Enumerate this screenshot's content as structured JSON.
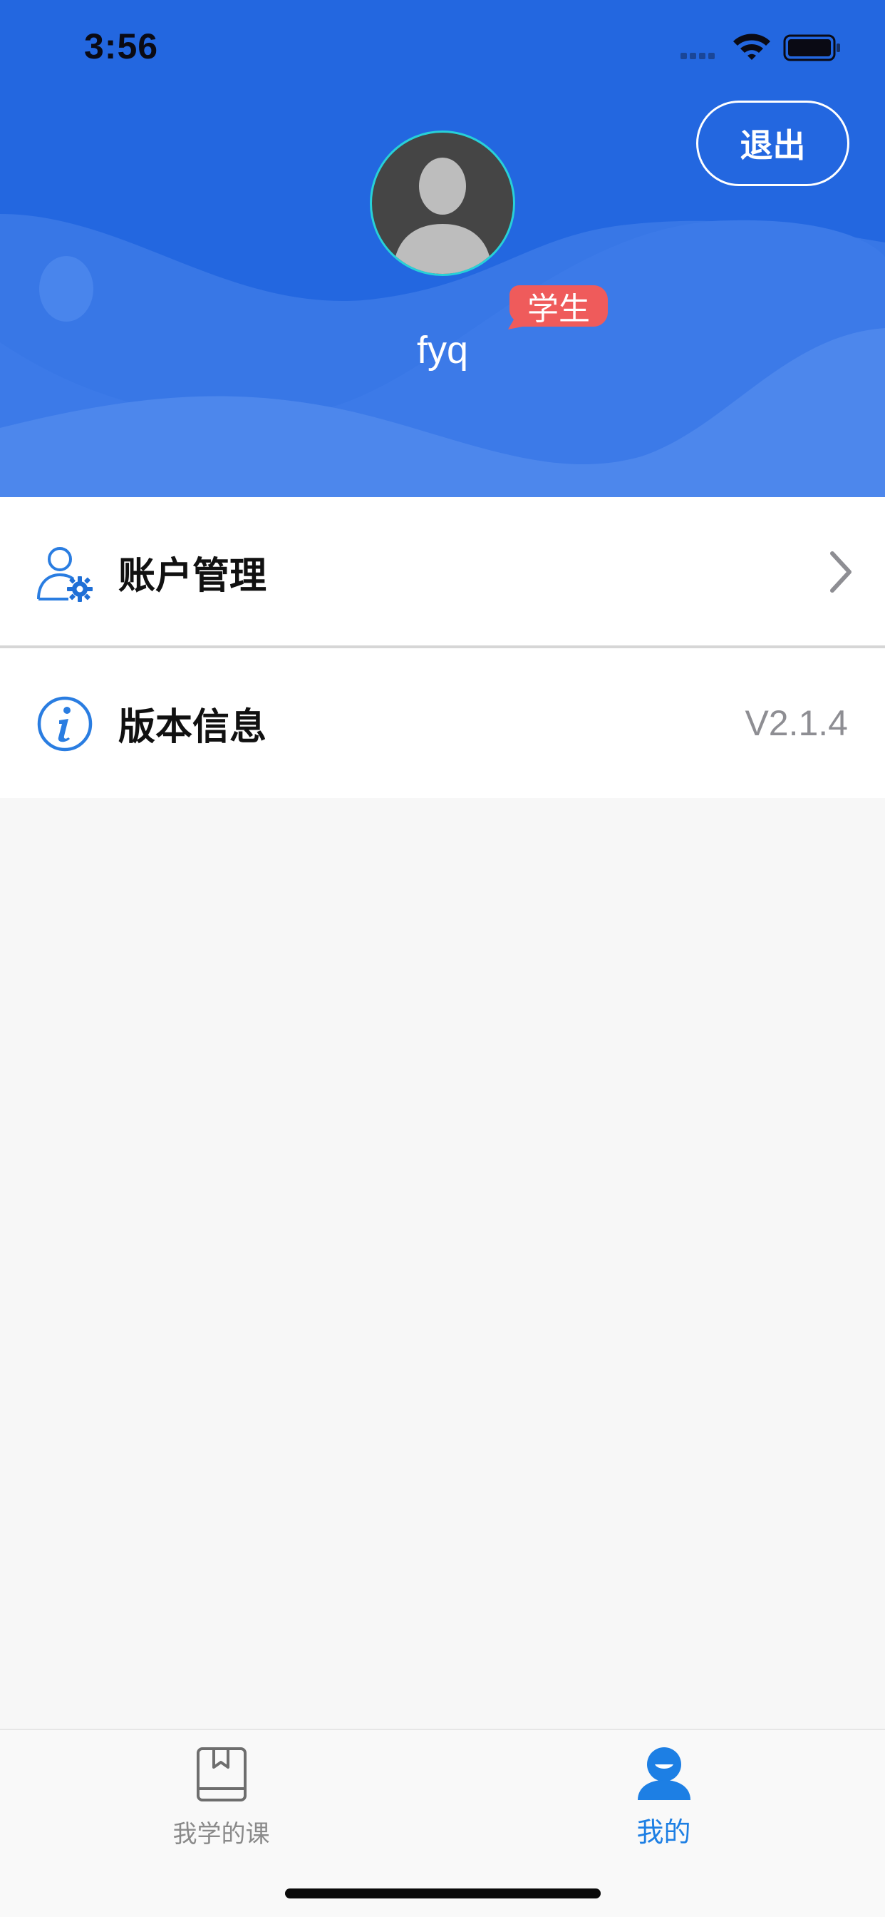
{
  "status_bar": {
    "time": "3:56"
  },
  "header": {
    "logout_label": "退出",
    "role_badge": "学生",
    "username": "fyq"
  },
  "menu": {
    "items": [
      {
        "label": "账户管理",
        "icon": "user-gear-icon",
        "trailing": "chevron-right-icon"
      },
      {
        "label": "版本信息",
        "icon": "info-icon",
        "value": "V2.1.4"
      }
    ]
  },
  "tabbar": {
    "tabs": [
      {
        "label": "我学的课",
        "icon": "book-icon",
        "active": false
      },
      {
        "label": "我的",
        "icon": "person-icon",
        "active": true
      }
    ]
  },
  "colors": {
    "header_blue": "#2367e0",
    "accent": "#1d7fe4",
    "badge_red": "#ef5b5b",
    "avatar_ring": "#27d1d8"
  }
}
